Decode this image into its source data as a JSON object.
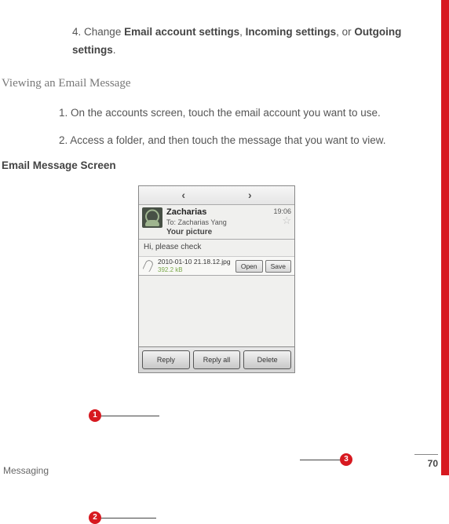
{
  "step4": {
    "num": "4.",
    "pre": "Change ",
    "b1": "Email account settings",
    "sep1": ", ",
    "b2": "Incoming settings",
    "sep2": ", or ",
    "b3": "Outgoing settings",
    "post": "."
  },
  "section_title": "Viewing an Email Message",
  "step1": "1. On the accounts screen, touch the email account you want to use.",
  "step2": "2. Access a folder, and then touch the message that you want to view.",
  "subhead": "Email Message Screen",
  "phone": {
    "nav_prev": "‹",
    "nav_next": "›",
    "sender": "Zacharias",
    "to": "To: Zacharias Yang",
    "subject": "Your picture",
    "time": "19:06",
    "star": "☆",
    "greeting": "Hi, please check",
    "attach_name": "2010-01-10 21.18.12.jpg",
    "attach_size": "392.2 kB",
    "open_btn": "Open",
    "save_btn": "Save",
    "reply": "Reply",
    "reply_all": "Reply all",
    "delete": "Delete"
  },
  "callouts": {
    "c1": "1",
    "c2": "2",
    "c3": "3"
  },
  "page_num": "70",
  "footer": "Messaging"
}
